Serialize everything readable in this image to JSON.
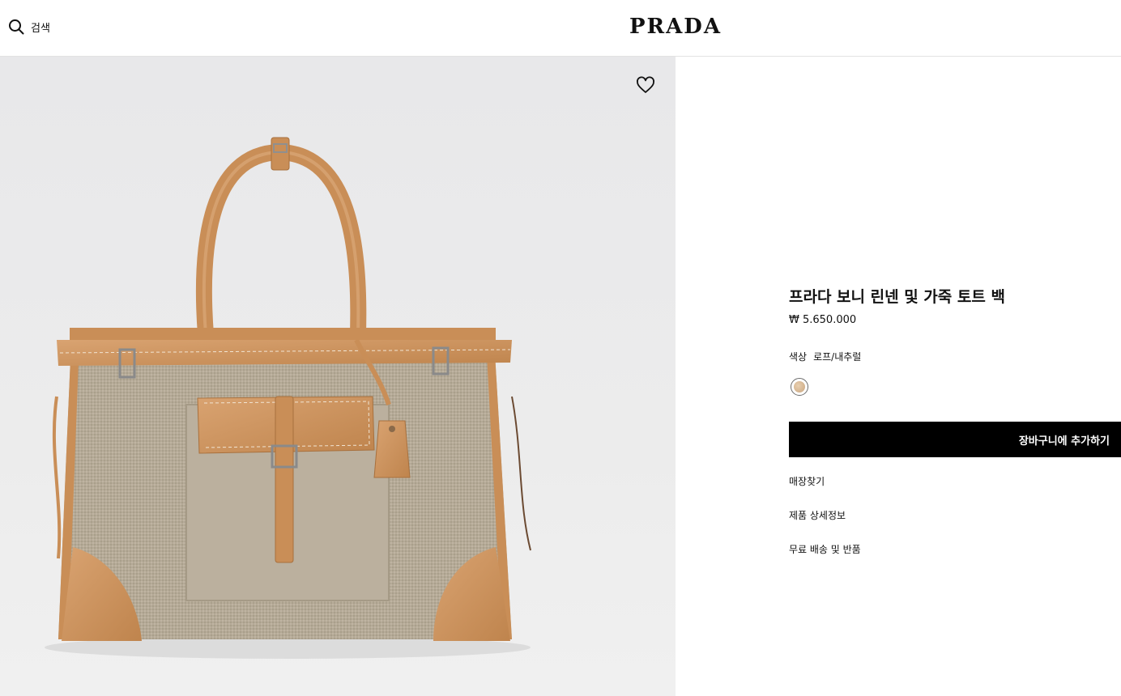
{
  "header": {
    "search_label": "검색",
    "logo": "PRADA"
  },
  "product": {
    "title": "프라다 보니 린넨 및 가죽 토트 백",
    "price": "₩ 5.650.000",
    "color_label": "색상",
    "color_value": "로프/내추럴",
    "add_to_cart": "장바구니에 추가하기",
    "links": [
      "매장찾기",
      "제품 상세정보",
      "무료 배송 및 반품"
    ],
    "swatch_colors": [
      "#e8cfb0",
      "#caa67f"
    ]
  },
  "icons": {
    "search": "search-icon",
    "wishlist": "heart-icon"
  },
  "colors": {
    "leather": "#c98e57",
    "canvas": "#b6ab98",
    "button": "#000000"
  }
}
